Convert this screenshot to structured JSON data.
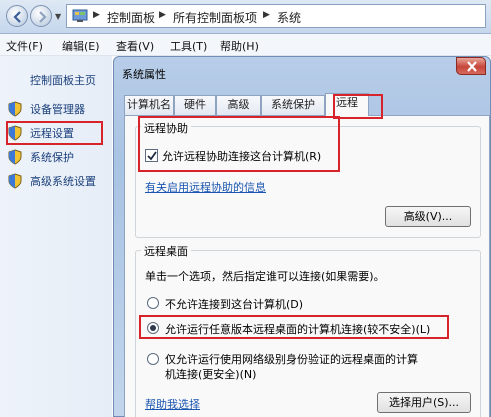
{
  "address_bar": {
    "breadcrumbs": [
      "控制面板",
      "所有控制面板项",
      "系统"
    ]
  },
  "menu": {
    "items": [
      "文件(F)",
      "编辑(E)",
      "查看(V)",
      "工具(T)",
      "帮助(H)"
    ]
  },
  "sidebar": {
    "home": "控制面板主页",
    "items": [
      {
        "label": "设备管理器",
        "icon": "shield-icon"
      },
      {
        "label": "远程设置",
        "icon": "shield-icon",
        "highlighted": true
      },
      {
        "label": "系统保护",
        "icon": "shield-icon"
      },
      {
        "label": "高级系统设置",
        "icon": "shield-icon"
      }
    ]
  },
  "dialog": {
    "title": "系统属性",
    "tabs": [
      "计算机名",
      "硬件",
      "高级",
      "系统保护",
      "远程"
    ],
    "active_tab": "远程",
    "remote_assistance": {
      "group_title": "远程协助",
      "checkbox_label": "允许远程协助连接这台计算机(R)",
      "checked": true,
      "link": "有关启用远程协助的信息",
      "advanced_button": "高级(V)..."
    },
    "remote_desktop": {
      "group_title": "远程桌面",
      "instruction": "单击一个选项，然后指定谁可以连接(如果需要)。",
      "options": [
        {
          "label": "不允许连接到这台计算机(D)",
          "selected": false
        },
        {
          "label": "允许运行任意版本远程桌面的计算机连接(较不安全)(L)",
          "selected": true
        },
        {
          "label_line1": "仅允许运行使用网络级别身份验证的远程桌面的计算",
          "label_line2": "机连接(更安全)(N)",
          "selected": false
        }
      ],
      "help_link": "帮助我选择",
      "select_users_button": "选择用户(S)..."
    }
  },
  "colors": {
    "highlight_red": "#d6242a",
    "link_blue": "#1a56b0",
    "dialog_frame": "#a9c3e3"
  }
}
